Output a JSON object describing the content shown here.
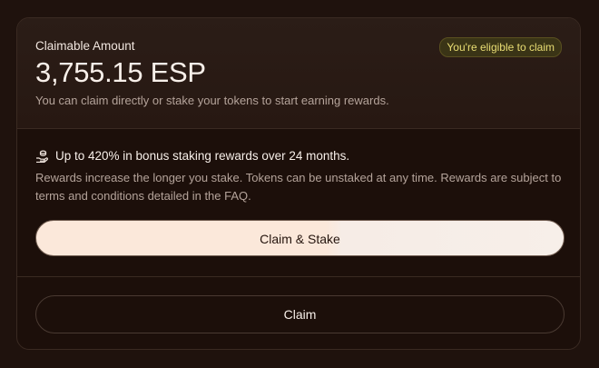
{
  "claim": {
    "label": "Claimable Amount",
    "badge": "You're eligible to claim",
    "amount": "3,755.15 ESP",
    "subtitle": "You can claim directly or stake your tokens to start earning rewards."
  },
  "bonus": {
    "icon": "stake-coins-icon",
    "headline": "Up to 420% in bonus staking rewards over 24 months.",
    "description": "Rewards increase the longer you stake. Tokens can be unstaked at any time. Rewards are subject to terms and conditions detailed in the FAQ."
  },
  "buttons": {
    "claim_stake": "Claim & Stake",
    "claim": "Claim"
  },
  "colors": {
    "background": "#1f120d",
    "badge_text": "#e9dd73",
    "primary_button": "#fbe8da"
  }
}
